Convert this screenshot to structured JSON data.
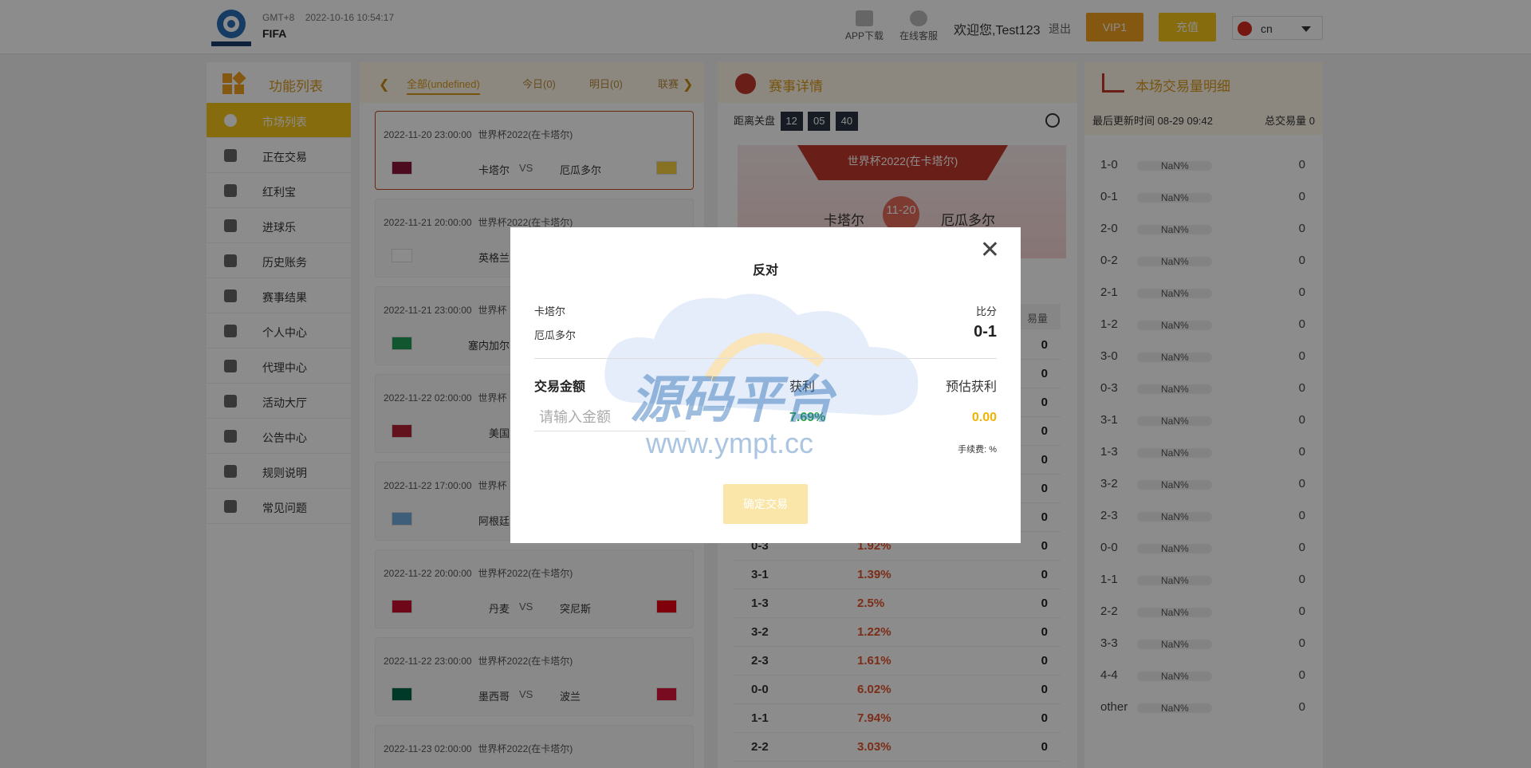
{
  "header": {
    "timezone": "GMT+8",
    "datetime": "2022-10-16 10:54:17",
    "site_name": "FIFA",
    "app_download": "APP下载",
    "online_service": "在线客服",
    "welcome": "欢迎您,Test123",
    "logout": "退出",
    "vip": "VIP1",
    "recharge": "充值",
    "language": "cn"
  },
  "sidebar": {
    "title": "功能列表",
    "items": [
      {
        "label": "市场列表",
        "icon": "soccer-ball-icon"
      },
      {
        "label": "正在交易",
        "icon": "money-bag-icon"
      },
      {
        "label": "红利宝",
        "icon": "coins-icon"
      },
      {
        "label": "进球乐",
        "icon": "goal-net-icon"
      },
      {
        "label": "历史账务",
        "icon": "ledger-icon"
      },
      {
        "label": "赛事结果",
        "icon": "trophy-icon"
      },
      {
        "label": "个人中心",
        "icon": "user-icon"
      },
      {
        "label": "代理中心",
        "icon": "hierarchy-icon"
      },
      {
        "label": "活动大厅",
        "icon": "gift-icon"
      },
      {
        "label": "公告中心",
        "icon": "announcement-icon"
      },
      {
        "label": "规则说明",
        "icon": "rules-icon"
      },
      {
        "label": "常见问题",
        "icon": "question-icon"
      }
    ]
  },
  "tabs": [
    "全部(undefined)",
    "今日(0)",
    "明日(0)",
    "联赛"
  ],
  "matches": [
    {
      "time": "2022-11-20 23:00:00",
      "league": "世界杯2022(在卡塔尔)",
      "home": "卡塔尔",
      "away": "厄瓜多尔",
      "vs": "VS"
    },
    {
      "time": "2022-11-21 20:00:00",
      "league": "世界杯2022(在卡塔尔)",
      "home": "英格兰",
      "away": "",
      "vs": ""
    },
    {
      "time": "2022-11-21 23:00:00",
      "league": "世界杯",
      "home": "塞内加尔",
      "away": "",
      "vs": ""
    },
    {
      "time": "2022-11-22 02:00:00",
      "league": "世界杯",
      "home": "美国",
      "away": "",
      "vs": ""
    },
    {
      "time": "2022-11-22 17:00:00",
      "league": "世界杯",
      "home": "阿根廷",
      "away": "",
      "vs": ""
    },
    {
      "time": "2022-11-22 20:00:00",
      "league": "世界杯2022(在卡塔尔)",
      "home": "丹麦",
      "away": "突尼斯",
      "vs": "VS"
    },
    {
      "time": "2022-11-22 23:00:00",
      "league": "世界杯2022(在卡塔尔)",
      "home": "墨西哥",
      "away": "波兰",
      "vs": "VS"
    },
    {
      "time": "2022-11-23 02:00:00",
      "league": "世界杯2022(在卡塔尔)",
      "home": "",
      "away": "",
      "vs": ""
    }
  ],
  "details": {
    "title": "赛事详情",
    "countdown_label": "距离关盘",
    "countdown": [
      "12",
      "05",
      "40"
    ],
    "league": "世界杯2022(在卡塔尔)",
    "home": "卡塔尔",
    "away": "厄瓜多尔",
    "date": "11-20",
    "col_volume": "易量",
    "odds": [
      {
        "score": "",
        "pct": "",
        "vol": "0"
      },
      {
        "score": "",
        "pct": "",
        "vol": "0"
      },
      {
        "score": "",
        "pct": "",
        "vol": "0"
      },
      {
        "score": "",
        "pct": "",
        "vol": "0"
      },
      {
        "score": "",
        "pct": "",
        "vol": "0"
      },
      {
        "score": "",
        "pct": "",
        "vol": "0"
      },
      {
        "score": "",
        "pct": "",
        "vol": "0"
      },
      {
        "score": "0-3",
        "pct": "1.92%",
        "vol": "0"
      },
      {
        "score": "3-1",
        "pct": "1.39%",
        "vol": "0"
      },
      {
        "score": "1-3",
        "pct": "2.5%",
        "vol": "0"
      },
      {
        "score": "3-2",
        "pct": "1.22%",
        "vol": "0"
      },
      {
        "score": "2-3",
        "pct": "1.61%",
        "vol": "0"
      },
      {
        "score": "0-0",
        "pct": "6.02%",
        "vol": "0"
      },
      {
        "score": "1-1",
        "pct": "7.94%",
        "vol": "0"
      },
      {
        "score": "2-2",
        "pct": "3.03%",
        "vol": "0"
      }
    ]
  },
  "volume": {
    "title": "本场交易量明细",
    "updated": "最后更新时间 08-29 09:42",
    "total": "总交易量 0",
    "rows": [
      {
        "score": "1-0",
        "pct": "NaN%",
        "n": "0"
      },
      {
        "score": "0-1",
        "pct": "NaN%",
        "n": "0"
      },
      {
        "score": "2-0",
        "pct": "NaN%",
        "n": "0"
      },
      {
        "score": "0-2",
        "pct": "NaN%",
        "n": "0"
      },
      {
        "score": "2-1",
        "pct": "NaN%",
        "n": "0"
      },
      {
        "score": "1-2",
        "pct": "NaN%",
        "n": "0"
      },
      {
        "score": "3-0",
        "pct": "NaN%",
        "n": "0"
      },
      {
        "score": "0-3",
        "pct": "NaN%",
        "n": "0"
      },
      {
        "score": "3-1",
        "pct": "NaN%",
        "n": "0"
      },
      {
        "score": "1-3",
        "pct": "NaN%",
        "n": "0"
      },
      {
        "score": "3-2",
        "pct": "NaN%",
        "n": "0"
      },
      {
        "score": "2-3",
        "pct": "NaN%",
        "n": "0"
      },
      {
        "score": "0-0",
        "pct": "NaN%",
        "n": "0"
      },
      {
        "score": "1-1",
        "pct": "NaN%",
        "n": "0"
      },
      {
        "score": "2-2",
        "pct": "NaN%",
        "n": "0"
      },
      {
        "score": "3-3",
        "pct": "NaN%",
        "n": "0"
      },
      {
        "score": "4-4",
        "pct": "NaN%",
        "n": "0"
      },
      {
        "score": "other",
        "pct": "NaN%",
        "n": "0"
      }
    ]
  },
  "modal": {
    "title": "反对",
    "home": "卡塔尔",
    "away": "厄瓜多尔",
    "score_label": "比分",
    "score": "0-1",
    "amount_label": "交易金额",
    "amount_placeholder": "请输入金额",
    "profit_label": "获利",
    "profit": "7.69%",
    "est_label": "预估获利",
    "est": "0.00",
    "fee": "手续费: %",
    "confirm": "确定交易",
    "close": "✕"
  },
  "watermark": {
    "text": "源码平台",
    "url": "www.ympt.cc"
  },
  "colors": {
    "accent": "#f5c518",
    "brand_orange": "#f0a020",
    "odds_red": "#e2522a",
    "profit_green": "#2aa14a"
  }
}
